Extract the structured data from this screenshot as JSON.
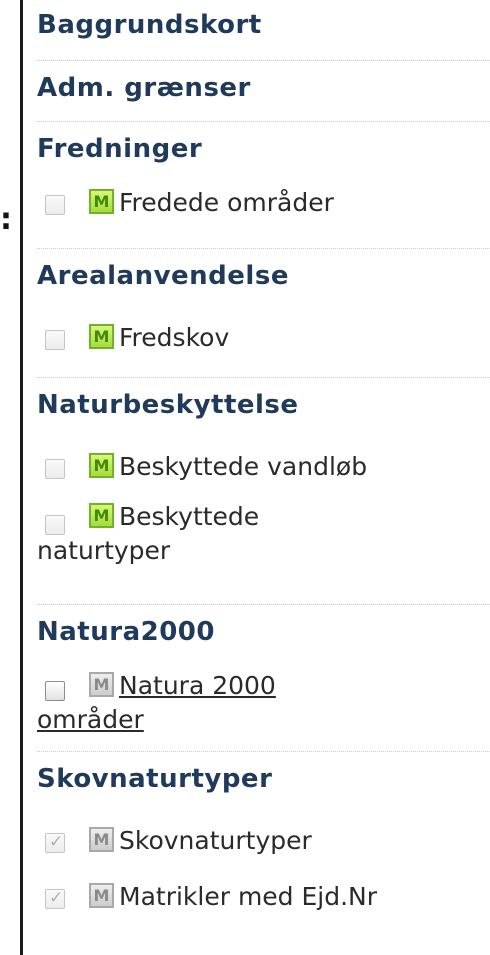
{
  "colon": ":",
  "groups": [
    {
      "title": "Baggrundskort",
      "layers": []
    },
    {
      "title": "Adm. grænser",
      "layers": []
    },
    {
      "title": "Fredninger",
      "layers": [
        {
          "label": "Fredede områder",
          "icon": "map-layer-icon-green",
          "checked": false
        }
      ]
    },
    {
      "title": "Arealanvendelse",
      "layers": [
        {
          "label": "Fredskov",
          "icon": "map-layer-icon-green",
          "checked": false
        }
      ]
    },
    {
      "title": "Naturbeskyttelse",
      "layers": [
        {
          "label": "Beskyttede vandløb",
          "icon": "map-layer-icon-green",
          "checked": false
        },
        {
          "label": "Beskyttede naturtyper",
          "icon": "map-layer-icon-green",
          "checked": false
        }
      ]
    },
    {
      "title": "Natura2000",
      "layers": [
        {
          "label": "Natura 2000 områder",
          "icon": "map-layer-icon-gray",
          "checked": false,
          "link": true
        }
      ]
    },
    {
      "title": "Skovnaturtyper",
      "layers": [
        {
          "label": "Skovnaturtyper",
          "icon": "map-layer-icon-gray",
          "checked": true,
          "disabled": true
        },
        {
          "label": "Matrikler med Ejd.Nr",
          "icon": "map-layer-icon-gray",
          "checked": true,
          "disabled": true
        }
      ]
    }
  ],
  "icon_letter": "M",
  "colors": {
    "header": "#1f3a5a",
    "icon_green": "#a7db3a",
    "icon_gray": "#cdcdcd",
    "panel_border": "#1a1a1a"
  }
}
